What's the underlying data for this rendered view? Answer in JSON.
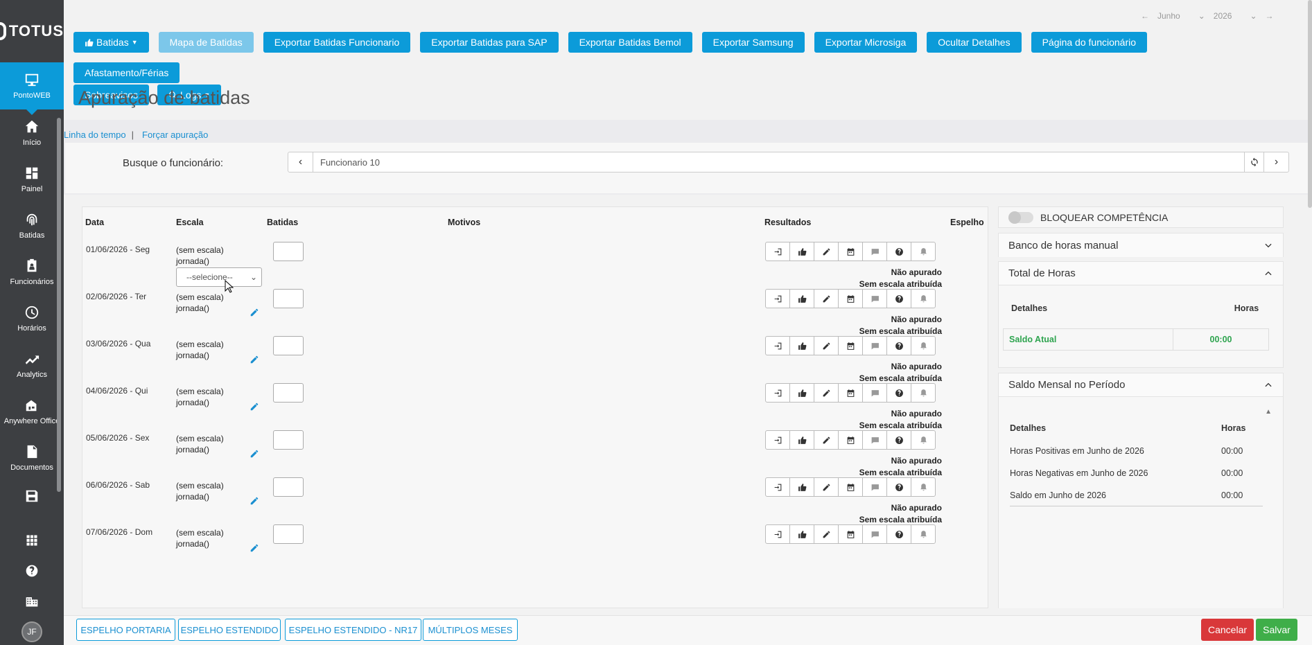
{
  "sidebar": {
    "logo": "TOTUS",
    "items": [
      {
        "label": "PontoWEB",
        "icon": "monitor-icon",
        "active": true
      },
      {
        "label": "Início",
        "icon": "home-icon"
      },
      {
        "label": "Painel",
        "icon": "dashboard-icon"
      },
      {
        "label": "Batidas",
        "icon": "fingerprint-icon"
      },
      {
        "label": "Funcionários",
        "icon": "badge-icon"
      },
      {
        "label": "Horários",
        "icon": "clock-icon"
      },
      {
        "label": "Analytics",
        "icon": "trend-icon"
      },
      {
        "label": "Anywhere Office",
        "icon": "house-office-icon"
      },
      {
        "label": "Documentos",
        "icon": "document-icon"
      }
    ],
    "avatar": "JF"
  },
  "month_nav": {
    "month": "Junho",
    "year": "2026"
  },
  "toolbar": {
    "batidas": "Batidas",
    "mapa": "Mapa de Batidas",
    "exp_func": "Exportar Batidas Funcionario",
    "exp_sap": "Exportar Batidas para SAP",
    "exp_bemol": "Exportar Batidas Bemol",
    "exp_samsung": "Exportar Samsung",
    "exp_microsiga": "Exportar Microsiga",
    "ocultar": "Ocultar Detalhes",
    "pagina": "Página do funcionário",
    "afastamento": "Afastamento/Férias",
    "sobreavisos": "Sobreavisos",
    "logs": "Logs"
  },
  "page": {
    "title": "Apuração de batidas",
    "link_timeline": "Linha do tempo",
    "link_sep": "|",
    "link_force": "Forçar apuração",
    "search_label": "Busque o funcionário:",
    "employee": "Funcionario 10"
  },
  "table": {
    "headers": {
      "data": "Data",
      "escala": "Escala",
      "batidas": "Batidas",
      "motivos": "Motivos",
      "resultados": "Resultados",
      "espelho": "Espelho"
    },
    "select_placeholder": "--selecione--",
    "days": [
      {
        "date": "01/06/2026 - Seg",
        "escala": "(sem escala)",
        "jornada": "jornada()",
        "status1": "Não apurado",
        "status2": "Sem escala atribuída"
      },
      {
        "date": "02/06/2026 - Ter",
        "escala": "(sem escala)",
        "jornada": "jornada()",
        "status1": "Não apurado",
        "status2": "Sem escala atribuída"
      },
      {
        "date": "03/06/2026 - Qua",
        "escala": "(sem escala)",
        "jornada": "jornada()",
        "status1": "Não apurado",
        "status2": "Sem escala atribuída"
      },
      {
        "date": "04/06/2026 - Qui",
        "escala": "(sem escala)",
        "jornada": "jornada()",
        "status1": "Não apurado",
        "status2": "Sem escala atribuída"
      },
      {
        "date": "05/06/2026 - Sex",
        "escala": "(sem escala)",
        "jornada": "jornada()",
        "status1": "Não apurado",
        "status2": "Sem escala atribuída"
      },
      {
        "date": "06/06/2026 - Sab",
        "escala": "(sem escala)",
        "jornada": "jornada()",
        "status1": "Não apurado",
        "status2": "Sem escala atribuída"
      },
      {
        "date": "07/06/2026 - Dom",
        "escala": "(sem escala)",
        "jornada": "jornada()",
        "status1": "",
        "status2": ""
      }
    ]
  },
  "right": {
    "bloquear": "BLOQUEAR COMPETÊNCIA",
    "banco": "Banco de horas manual",
    "total": {
      "title": "Total de Horas",
      "col_detalhes": "Detalhes",
      "col_horas": "Horas",
      "saldo_label": "Saldo Atual",
      "saldo_value": "00:00"
    },
    "mensal": {
      "title": "Saldo Mensal no Período",
      "col_detalhes": "Detalhes",
      "col_horas": "Horas",
      "rows": [
        {
          "label": "Horas Positivas em Junho de 2026",
          "value": "00:00"
        },
        {
          "label": "Horas Negativas em Junho de 2026",
          "value": "00:00"
        },
        {
          "label": "Saldo em Junho de 2026",
          "value": "00:00"
        }
      ]
    }
  },
  "bottom": {
    "espelho_portaria": "ESPELHO PORTARIA",
    "espelho_estendido": "ESPELHO ESTENDIDO",
    "espelho_nr17": "ESPELHO ESTENDIDO - NR17",
    "multiplos": "MÚLTIPLOS MESES",
    "cancelar": "Cancelar",
    "salvar": "Salvar"
  },
  "colors": {
    "primary": "#0c9bd9",
    "sidebar": "#3d3f42",
    "danger": "#d9383a",
    "success": "#3fae49",
    "saldo_green": "#2ea44f"
  }
}
